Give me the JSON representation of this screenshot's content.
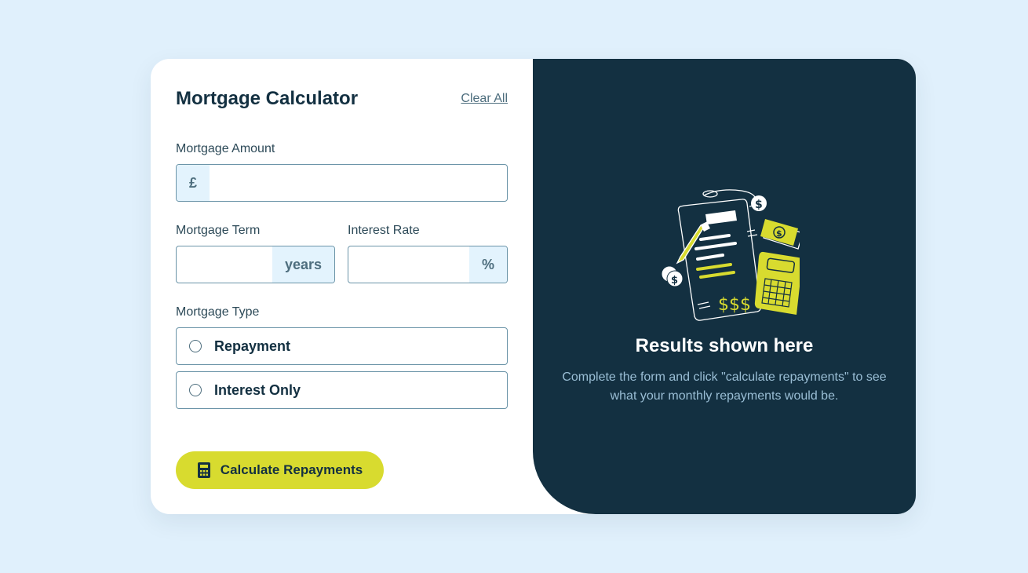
{
  "form": {
    "title": "Mortgage Calculator",
    "clear_label": "Clear All",
    "amount": {
      "label": "Mortgage Amount",
      "prefix": "£",
      "value": "",
      "placeholder": ""
    },
    "term": {
      "label": "Mortgage Term",
      "suffix": "years",
      "value": "",
      "placeholder": ""
    },
    "rate": {
      "label": "Interest Rate",
      "suffix": "%",
      "value": "",
      "placeholder": ""
    },
    "type": {
      "label": "Mortgage Type",
      "options": [
        {
          "label": "Repayment",
          "selected": false
        },
        {
          "label": "Interest Only",
          "selected": false
        }
      ]
    },
    "submit_label": "Calculate Repayments",
    "submit_icon": "calculator-icon"
  },
  "results": {
    "illustration": "empty-results-illustration",
    "title": "Results shown here",
    "text": "Complete the form and click \"calculate repayments\" to see what your monthly repayments would be."
  },
  "colors": {
    "background": "#e0f0fc",
    "accent": "#d8db2f",
    "dark": "#133041",
    "border": "#6b94a8",
    "affix_bg": "#e3f3fd"
  }
}
